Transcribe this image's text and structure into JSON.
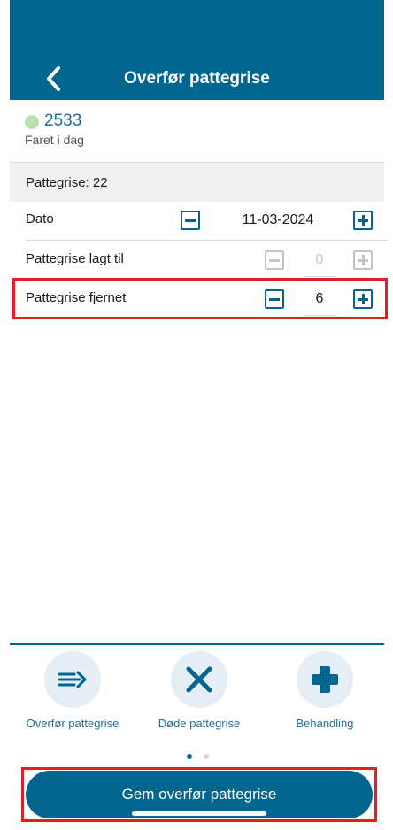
{
  "header": {
    "title": "Overfør pattegrise"
  },
  "animal": {
    "id": "2533",
    "status": "Faret i dag",
    "status_color": "#b9e0b0"
  },
  "count": {
    "label": "Pattegrise: 22"
  },
  "rows": [
    {
      "label": "Dato",
      "value": "11-03-2024",
      "enabled": true
    },
    {
      "label": "Pattegrise lagt til",
      "value": "0",
      "enabled": false
    },
    {
      "label": "Pattegrise fjernet",
      "value": "6",
      "enabled": true
    }
  ],
  "nav": [
    {
      "label": "Overfør pattegrise",
      "icon": "transfer-arrow-icon"
    },
    {
      "label": "Døde pattegrise",
      "icon": "x-icon"
    },
    {
      "label": "Behandling",
      "icon": "plus-cross-icon"
    }
  ],
  "pagination": {
    "current": 1,
    "total": 2
  },
  "save": {
    "label": "Gem overfør pattegrise"
  },
  "colors": {
    "primary": "#02668f",
    "highlight": "#e31e24",
    "disabled": "#c4c4c4"
  }
}
